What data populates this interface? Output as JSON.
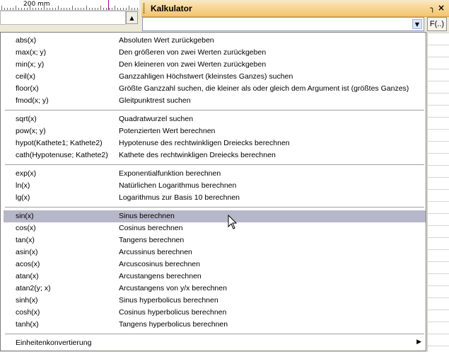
{
  "ruler": {
    "label": "200 mm"
  },
  "panel": {
    "title": "Kalkulator",
    "pin_icon": "pin-icon",
    "close_icon": "close-icon"
  },
  "calculator": {
    "value": "",
    "function_button_label": "F(..)"
  },
  "menu": {
    "groups": [
      [
        {
          "fn": "abs(x)",
          "desc": "Absoluten Wert zurückgeben"
        },
        {
          "fn": "max(x; y)",
          "desc": "Den größeren von zwei Werten zurückgeben"
        },
        {
          "fn": "min(x; y)",
          "desc": "Den kleineren von zwei Werten zurückgeben"
        },
        {
          "fn": "ceil(x)",
          "desc": "Ganzzahligen Höchstwert (kleinstes Ganzes) suchen"
        },
        {
          "fn": "floor(x)",
          "desc": "Größte Ganzzahl suchen, die kleiner als oder gleich dem Argument ist (größtes Ganzes)"
        },
        {
          "fn": "fmod(x; y)",
          "desc": "Gleitpunktrest suchen"
        }
      ],
      [
        {
          "fn": "sqrt(x)",
          "desc": "Quadratwurzel suchen"
        },
        {
          "fn": "pow(x; y)",
          "desc": "Potenzierten Wert berechnen"
        },
        {
          "fn": "hypot(Kathete1; Kathete2)",
          "desc": "Hypotenuse des rechtwinkligen Dreiecks berechnen"
        },
        {
          "fn": "cath(Hypotenuse; Kathete2)",
          "desc": "Kathete des rechtwinkligen Dreiecks berechnen"
        }
      ],
      [
        {
          "fn": "exp(x)",
          "desc": "Exponentialfunktion berechnen"
        },
        {
          "fn": "ln(x)",
          "desc": "Natürlichen Logarithmus berechnen"
        },
        {
          "fn": "lg(x)",
          "desc": "Logarithmus zur Basis 10 berechnen"
        }
      ],
      [
        {
          "fn": "sin(x)",
          "desc": "Sinus berechnen",
          "highlighted": true
        },
        {
          "fn": "cos(x)",
          "desc": "Cosinus berechnen"
        },
        {
          "fn": "tan(x)",
          "desc": "Tangens berechnen"
        },
        {
          "fn": "asin(x)",
          "desc": "Arcussinus berechnen"
        },
        {
          "fn": "acos(x)",
          "desc": "Arcuscosinus berechnen"
        },
        {
          "fn": "atan(x)",
          "desc": "Arcustangens berechnen"
        },
        {
          "fn": "atan2(y; x)",
          "desc": "Arcustangens von y/x berechnen"
        },
        {
          "fn": "sinh(x)",
          "desc": "Sinus hyperbolicus berechnen"
        },
        {
          "fn": "cosh(x)",
          "desc": "Cosinus hyperbolicus berechnen"
        },
        {
          "fn": "tanh(x)",
          "desc": "Tangens hyperbolicus berechnen"
        }
      ]
    ],
    "submenu": {
      "label": "Einheitenkonvertierung",
      "arrow_icon": "submenu-arrow-icon"
    }
  },
  "colors": {
    "highlight": "#b6b7c8",
    "header_top": "#fce6b8",
    "header_bottom": "#f3c46e"
  }
}
